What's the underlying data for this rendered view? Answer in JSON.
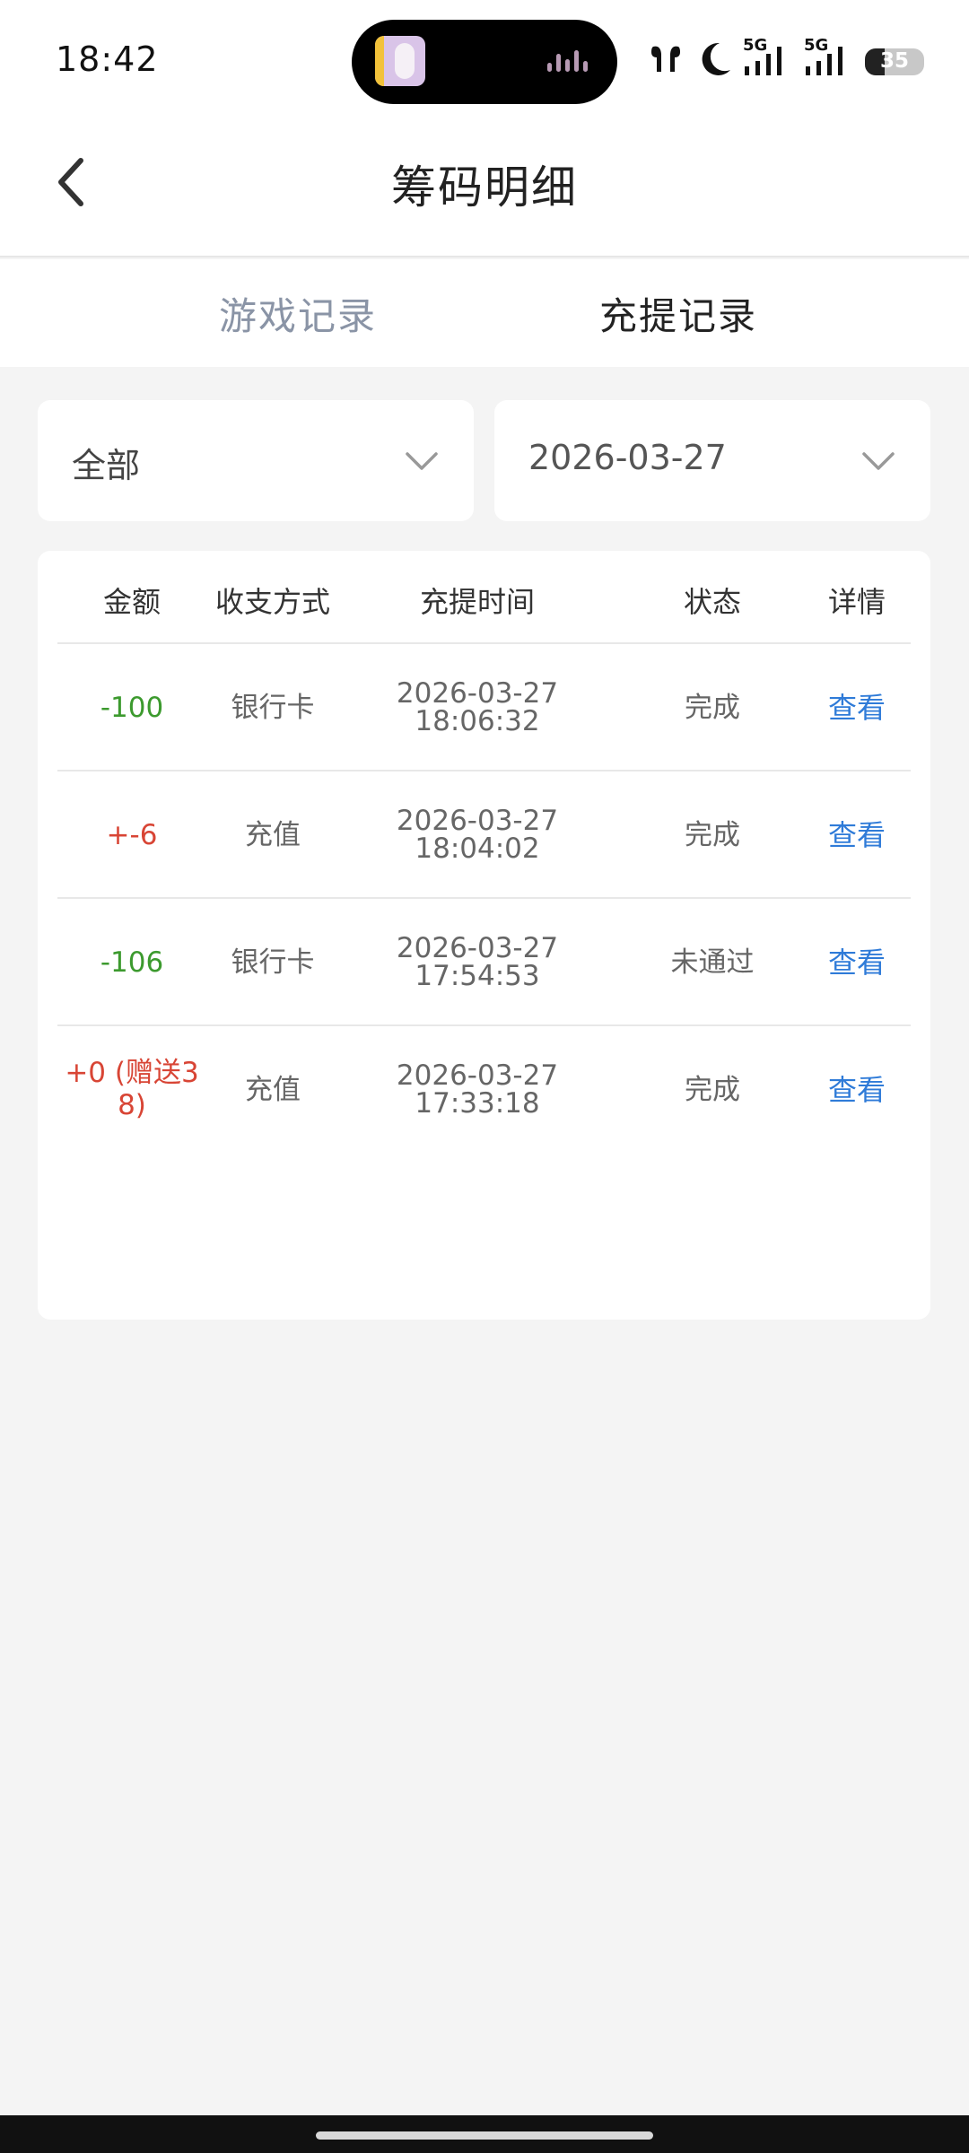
{
  "status_bar": {
    "time": "18:42",
    "battery": "35",
    "network_1": "5G",
    "network_2": "5G",
    "icons": [
      "earbuds-icon",
      "moon-icon",
      "signal-icon",
      "signal-icon",
      "battery-icon"
    ]
  },
  "header": {
    "title": "筹码明细",
    "back_icon": "chevron-left-icon"
  },
  "tabs": [
    {
      "label": "游戏记录",
      "active": false
    },
    {
      "label": "充提记录",
      "active": true
    }
  ],
  "filters": {
    "type_value": "全部",
    "date_value": "2026-03-27"
  },
  "table": {
    "columns": [
      "金额",
      "收支方式",
      "充提时间",
      "状态",
      "详情"
    ],
    "rows": [
      {
        "amount": "-100",
        "amount_kind": "negative",
        "method": "银行卡",
        "time": "2026-03-27 18:06:32",
        "status": "完成",
        "detail": "查看"
      },
      {
        "amount": "+-6",
        "amount_kind": "positive",
        "method": "充值",
        "time": "2026-03-27 18:04:02",
        "status": "完成",
        "detail": "查看"
      },
      {
        "amount": "-106",
        "amount_kind": "negative",
        "method": "银行卡",
        "time": "2026-03-27 17:54:53",
        "status": "未通过",
        "detail": "查看"
      },
      {
        "amount": "+0 (赠送38)",
        "amount_kind": "positive",
        "method": "充值",
        "time": "2026-03-27 17:33:18",
        "status": "完成",
        "detail": "查看"
      }
    ]
  },
  "colors": {
    "negative": "#3c9a2e",
    "positive": "#d84535",
    "link": "#2f7bd8",
    "tab_inactive": "#8a94a6",
    "background": "#f4f4f4"
  }
}
